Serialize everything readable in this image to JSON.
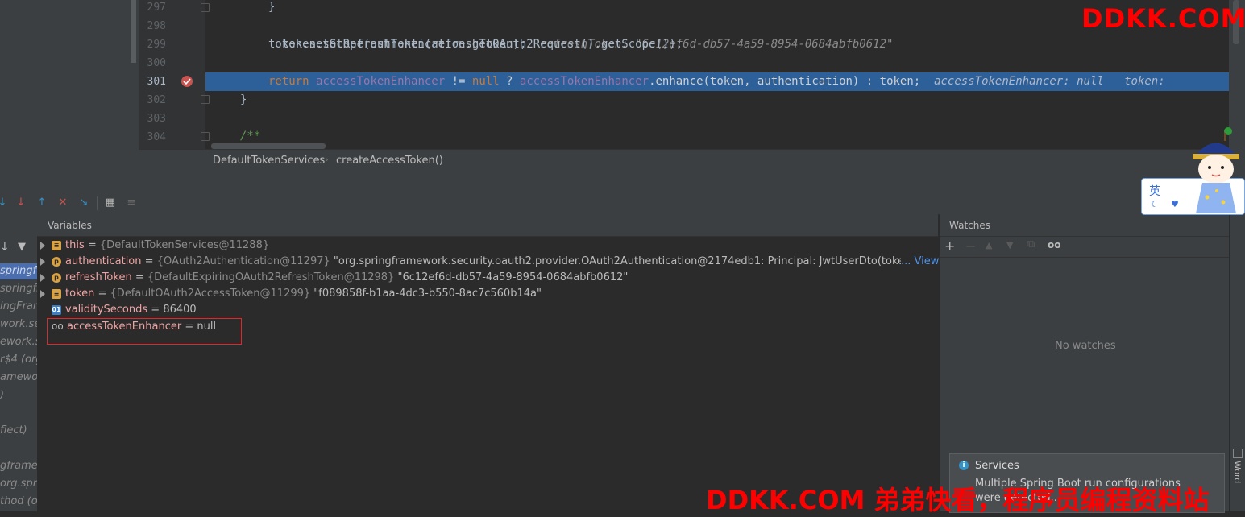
{
  "editor": {
    "lines": [
      {
        "num": "297",
        "code": "}"
      },
      {
        "num": "298",
        "code": "token.setRefreshToken(refreshToken);",
        "inline": "refreshToken: \"6c12ef6d-db57-4a59-8954-0684abfb0612\""
      },
      {
        "num": "299",
        "code": "token.setScope(authentication.getOAuth2Request().getScope());"
      },
      {
        "num": "300",
        "code": ""
      },
      {
        "num": "301",
        "kw_return": "return",
        "f1": "accessTokenEnhancer",
        "op1": " != ",
        "kw_null": "null",
        "op2": " ? ",
        "f2": "accessTokenEnhancer",
        "rest": ".enhance(token, authentication) : token;",
        "inline": "accessTokenEnhancer: null   token:"
      },
      {
        "num": "302",
        "code": "}"
      },
      {
        "num": "303",
        "code": ""
      },
      {
        "num": "304",
        "comment": "/**"
      }
    ],
    "breadcrumb": [
      "DefaultTokenServices",
      "createAccessToken()"
    ],
    "breadcrumb_sep": "›"
  },
  "debug": {
    "variables_title": "Variables",
    "watches_title": "Watches",
    "no_watches": "No watches",
    "frames": [
      "springf",
      "springfr",
      "ingFram",
      "work.secu",
      "ework.s",
      "r$4 (org",
      "amewo",
      ")",
      "flect)",
      "gframew",
      "org.spri",
      "thod (o"
    ],
    "variables": [
      {
        "name": "this",
        "eq": " = ",
        "meta": "{DefaultTokenServices@11288}",
        "value": ""
      },
      {
        "name": "authentication",
        "eq": " = ",
        "meta": "{OAuth2Authentication@11297}",
        "value": " \"org.springframework.security.oauth2.provider.OAuth2Authentication@2174edb1: Principal: JwtUserDto(token=null, log",
        "link": "... View"
      },
      {
        "name": "refreshToken",
        "eq": " = ",
        "meta": "{DefaultExpiringOAuth2RefreshToken@11298}",
        "value": " \"6c12ef6d-db57-4a59-8954-0684abfb0612\""
      },
      {
        "name": "token",
        "eq": " = ",
        "meta": "{DefaultOAuth2AccessToken@11299}",
        "value": " \"f089858f-b1aa-4dc3-b550-8ac7c560b14a\""
      },
      {
        "name": "validitySeconds",
        "eq": " = ",
        "meta": "",
        "value": "86400"
      },
      {
        "name": "accessTokenEnhancer",
        "eq": " = ",
        "meta": "",
        "value": "null"
      }
    ],
    "toolbar_icons": [
      "step-over-icon",
      "step-into-icon",
      "step-out-icon",
      "drop-frame-icon",
      "run-to-cursor-icon",
      "evaluate-icon",
      "trace-icon"
    ],
    "watch_icons": [
      "+",
      "−",
      "▲",
      "▼",
      "⧉",
      "oo"
    ]
  },
  "services": {
    "title": "Services",
    "line1": "Multiple Spring Boot run configurations",
    "line2": "were detected..."
  },
  "watermark": {
    "top": "DDKK.COM",
    "bottom": "DDKK.COM 弟弟快看，程序员编程资料站"
  },
  "mascot": {
    "char": "英"
  },
  "side_labels": {
    "word": "Word"
  },
  "colors": {
    "exec_line": "#2d6099",
    "breakpoint": "#c75450",
    "watermark": "#ff0000"
  }
}
